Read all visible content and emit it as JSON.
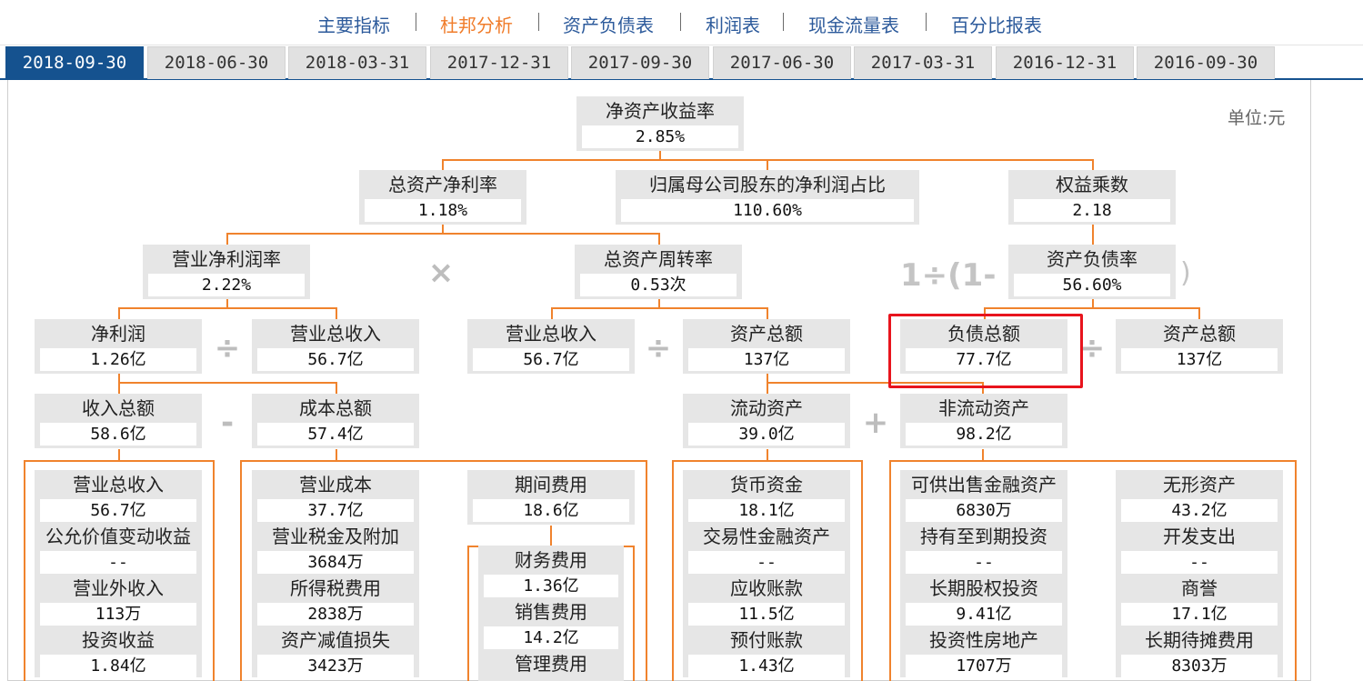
{
  "nav": {
    "items": [
      "主要指标",
      "杜邦分析",
      "资产负债表",
      "利润表",
      "现金流量表",
      "百分比报表"
    ],
    "active_index": 1
  },
  "tabs": {
    "dates": [
      "2018-09-30",
      "2018-06-30",
      "2018-03-31",
      "2017-12-31",
      "2017-09-30",
      "2017-06-30",
      "2017-03-31",
      "2016-12-31",
      "2016-09-30"
    ],
    "active_index": 0
  },
  "unit": "单位:元",
  "ops": {
    "times": "×",
    "divide": "÷",
    "minus": "-",
    "plus": "+",
    "wrap_left": "1÷(1-",
    "wrap_right": ")"
  },
  "tree": {
    "roe": {
      "label": "净资产收益率",
      "value": "2.85%"
    },
    "roa": {
      "label": "总资产净利率",
      "value": "1.18%"
    },
    "parent_np_ratio": {
      "label": "归属母公司股东的净利润占比",
      "value": "110.60%"
    },
    "equity_multiplier": {
      "label": "权益乘数",
      "value": "2.18"
    },
    "op_net_margin": {
      "label": "营业净利润率",
      "value": "2.22%"
    },
    "asset_turnover": {
      "label": "总资产周转率",
      "value": "0.53次"
    },
    "debt_ratio": {
      "label": "资产负债率",
      "value": "56.60%"
    },
    "net_profit": {
      "label": "净利润",
      "value": "1.26亿"
    },
    "revenue_a": {
      "label": "营业总收入",
      "value": "56.7亿"
    },
    "revenue_b": {
      "label": "营业总收入",
      "value": "56.7亿"
    },
    "total_assets_a": {
      "label": "资产总额",
      "value": "137亿"
    },
    "total_liab": {
      "label": "负债总额",
      "value": "77.7亿"
    },
    "total_assets_b": {
      "label": "资产总额",
      "value": "137亿"
    },
    "total_income": {
      "label": "收入总额",
      "value": "58.6亿"
    },
    "total_cost": {
      "label": "成本总额",
      "value": "57.4亿"
    },
    "current_assets": {
      "label": "流动资产",
      "value": "39.0亿"
    },
    "noncurrent_assets": {
      "label": "非流动资产",
      "value": "98.2亿"
    }
  },
  "groups": {
    "income": [
      {
        "label": "营业总收入",
        "value": "56.7亿"
      },
      {
        "label": "公允价值变动收益",
        "value": "--"
      },
      {
        "label": "营业外收入",
        "value": "113万"
      },
      {
        "label": "投资收益",
        "value": "1.84亿"
      }
    ],
    "cost": [
      {
        "label": "营业成本",
        "value": "37.7亿"
      },
      {
        "label": "营业税金及附加",
        "value": "3684万"
      },
      {
        "label": "所得税费用",
        "value": "2838万"
      },
      {
        "label": "资产减值损失",
        "value": "3423万"
      }
    ],
    "period_expense": {
      "label": "期间费用",
      "value": "18.6亿"
    },
    "expense_items": [
      {
        "label": "财务费用",
        "value": "1.36亿"
      },
      {
        "label": "销售费用",
        "value": "14.2亿"
      },
      {
        "label": "管理费用",
        "value": ""
      }
    ],
    "current": [
      {
        "label": "货币资金",
        "value": "18.1亿"
      },
      {
        "label": "交易性金融资产",
        "value": "--"
      },
      {
        "label": "应收账款",
        "value": "11.5亿"
      },
      {
        "label": "预付账款",
        "value": "1.43亿"
      }
    ],
    "noncurrent_left": [
      {
        "label": "可供出售金融资产",
        "value": "6830万"
      },
      {
        "label": "持有至到期投资",
        "value": "--"
      },
      {
        "label": "长期股权投资",
        "value": "9.41亿"
      },
      {
        "label": "投资性房地产",
        "value": "1707万"
      }
    ],
    "noncurrent_right": [
      {
        "label": "无形资产",
        "value": "43.2亿"
      },
      {
        "label": "开发支出",
        "value": "--"
      },
      {
        "label": "商誉",
        "value": "17.1亿"
      },
      {
        "label": "长期待摊费用",
        "value": "8303万"
      }
    ]
  }
}
